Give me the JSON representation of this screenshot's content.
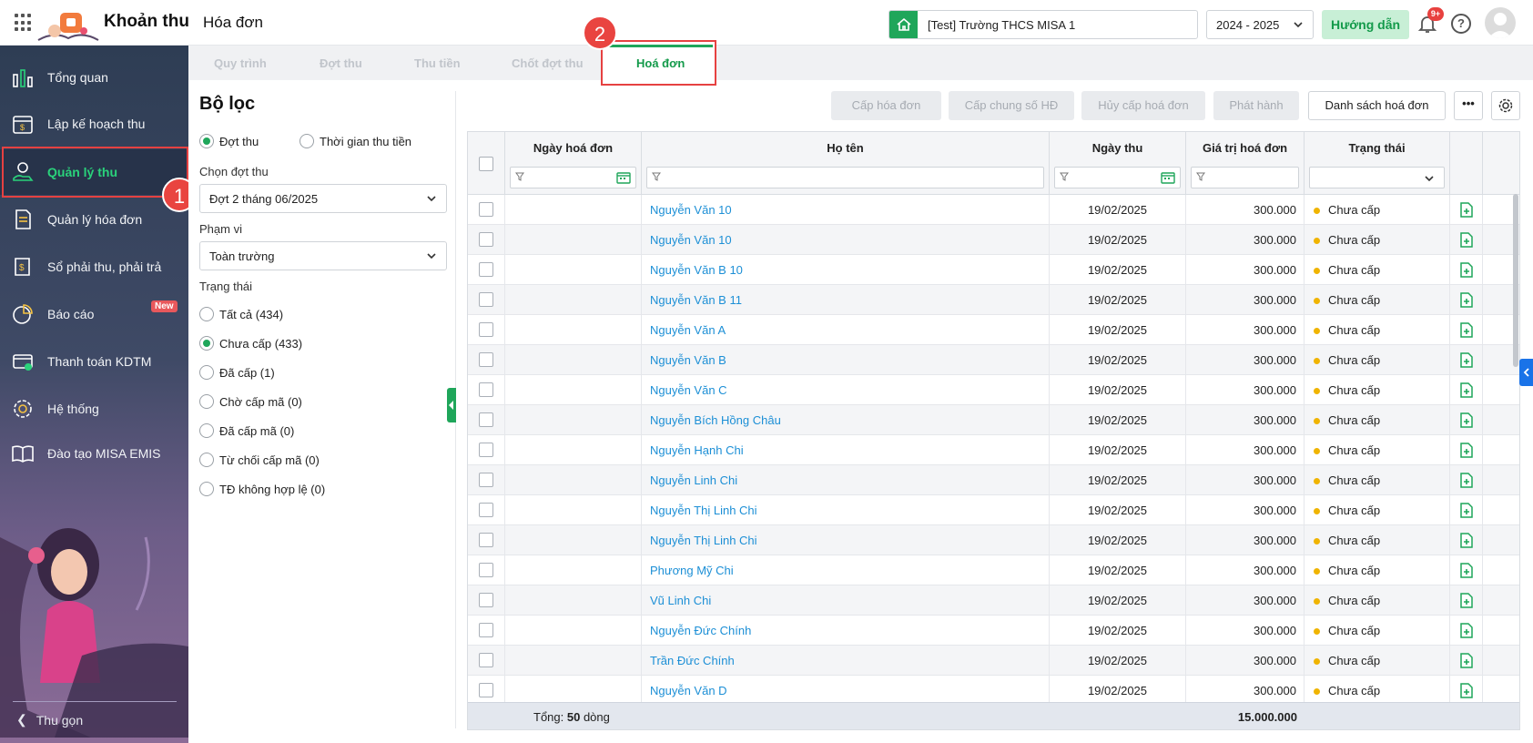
{
  "header": {
    "app_title": "Khoản thu",
    "page_title": "Hóa đơn",
    "school": "[Test] Trường THCS MISA 1",
    "school_year": "2024 - 2025",
    "guide_label": "Hướng dẫn",
    "notification_count": "9+"
  },
  "sidebar": {
    "items": [
      {
        "label": "Tổng quan",
        "icon": "bar-chart-icon"
      },
      {
        "label": "Lập kế hoạch thu",
        "icon": "calendar-money-icon"
      },
      {
        "label": "Quản lý thu",
        "icon": "hand-money-icon",
        "active": true
      },
      {
        "label": "Quản lý hóa đơn",
        "icon": "invoice-icon"
      },
      {
        "label": "Sổ phải thu, phải trả",
        "icon": "ledger-icon"
      },
      {
        "label": "Báo cáo",
        "icon": "pie-chart-icon"
      },
      {
        "label": "Thanh toán KDTM",
        "icon": "card-payment-icon"
      },
      {
        "label": "Hệ thống",
        "icon": "gear-icon"
      },
      {
        "label": "Đào tạo MISA EMIS",
        "icon": "book-icon"
      }
    ],
    "new_badge": "New",
    "collapse_label": "Thu gọn"
  },
  "markers": {
    "one": "1",
    "two": "2"
  },
  "tabs": [
    {
      "label": "Quy trình"
    },
    {
      "label": "Đợt thu"
    },
    {
      "label": "Thu tiền"
    },
    {
      "label": "Chốt đợt thu"
    },
    {
      "label": "Hoá đơn",
      "active": true
    }
  ],
  "filter": {
    "title": "Bộ lọc",
    "mode_options": [
      "Đợt thu",
      "Thời gian thu tiền"
    ],
    "period_label": "Chọn đợt thu",
    "period_value": "Đợt 2 tháng 06/2025",
    "scope_label": "Phạm vi",
    "scope_value": "Toàn trường",
    "status_label": "Trạng thái",
    "status_options": [
      {
        "label": "Tất cả (434)"
      },
      {
        "label": "Chưa cấp (433)",
        "selected": true
      },
      {
        "label": "Đã cấp (1)"
      },
      {
        "label": "Chờ cấp mã (0)"
      },
      {
        "label": "Đã cấp mã (0)"
      },
      {
        "label": "Từ chối cấp mã (0)"
      },
      {
        "label": "TĐ không hợp lệ (0)"
      }
    ]
  },
  "toolbar": {
    "issue": "Cấp hóa đơn",
    "issue_common": "Cấp chung số HĐ",
    "cancel_issue": "Hủy cấp hoá đơn",
    "publish": "Phát hành",
    "invoice_list": "Danh sách hoá đơn"
  },
  "table": {
    "columns": [
      "Ngày hoá đơn",
      "Họ tên",
      "Ngày thu",
      "Giá trị hoá đơn",
      "Trạng thái"
    ],
    "rows": [
      {
        "name": "Nguyễn Văn 10",
        "date": "19/02/2025",
        "amount": "300.000",
        "status": "Chưa cấp"
      },
      {
        "name": "Nguyễn Văn 10",
        "date": "19/02/2025",
        "amount": "300.000",
        "status": "Chưa cấp"
      },
      {
        "name": "Nguyễn Văn B 10",
        "date": "19/02/2025",
        "amount": "300.000",
        "status": "Chưa cấp"
      },
      {
        "name": "Nguyễn Văn B 11",
        "date": "19/02/2025",
        "amount": "300.000",
        "status": "Chưa cấp"
      },
      {
        "name": "Nguyễn Văn A",
        "date": "19/02/2025",
        "amount": "300.000",
        "status": "Chưa cấp"
      },
      {
        "name": "Nguyễn Văn B",
        "date": "19/02/2025",
        "amount": "300.000",
        "status": "Chưa cấp"
      },
      {
        "name": "Nguyễn Văn C",
        "date": "19/02/2025",
        "amount": "300.000",
        "status": "Chưa cấp"
      },
      {
        "name": "Nguyễn Bích Hồng Châu",
        "date": "19/02/2025",
        "amount": "300.000",
        "status": "Chưa cấp"
      },
      {
        "name": "Nguyễn Hạnh Chi",
        "date": "19/02/2025",
        "amount": "300.000",
        "status": "Chưa cấp"
      },
      {
        "name": "Nguyễn Linh Chi",
        "date": "19/02/2025",
        "amount": "300.000",
        "status": "Chưa cấp"
      },
      {
        "name": "Nguyễn Thị Linh Chi",
        "date": "19/02/2025",
        "amount": "300.000",
        "status": "Chưa cấp"
      },
      {
        "name": "Nguyễn Thị Linh Chi",
        "date": "19/02/2025",
        "amount": "300.000",
        "status": "Chưa cấp"
      },
      {
        "name": "Phương Mỹ Chi",
        "date": "19/02/2025",
        "amount": "300.000",
        "status": "Chưa cấp"
      },
      {
        "name": "Vũ Linh Chi",
        "date": "19/02/2025",
        "amount": "300.000",
        "status": "Chưa cấp"
      },
      {
        "name": "Nguyễn Đức Chính",
        "date": "19/02/2025",
        "amount": "300.000",
        "status": "Chưa cấp"
      },
      {
        "name": "Trần Đức Chính",
        "date": "19/02/2025",
        "amount": "300.000",
        "status": "Chưa cấp"
      },
      {
        "name": "Nguyễn Văn D",
        "date": "19/02/2025",
        "amount": "300.000",
        "status": "Chưa cấp"
      }
    ],
    "footer": {
      "prefix": "Tổng: ",
      "count": "50",
      "suffix": " dòng",
      "total": "15.000.000"
    }
  },
  "colors": {
    "accent": "#1fa65a",
    "link": "#1c8fd6",
    "status_dot": "#f0b400",
    "highlight": "#e64141"
  }
}
